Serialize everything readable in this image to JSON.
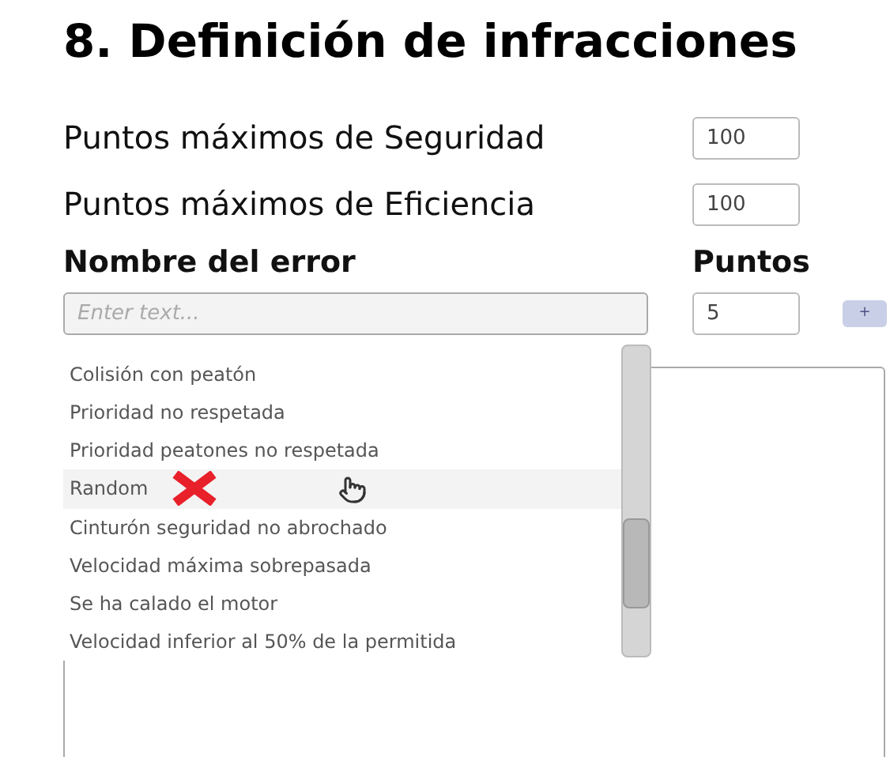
{
  "title": "8. Definición de infracciones",
  "max_points": [
    {
      "label": "Puntos máximos de Seguridad",
      "value": "100"
    },
    {
      "label": "Puntos máximos de Eficiencia",
      "value": "100"
    }
  ],
  "columns": {
    "name": "Nombre del error",
    "points": "Puntos"
  },
  "name_field": {
    "placeholder": "Enter text..."
  },
  "points_field": {
    "value": "5"
  },
  "add_button": {
    "label": "+",
    "disabled": true
  },
  "suggestions": [
    {
      "label": "Colisión con peatón",
      "hovered": false
    },
    {
      "label": "Prioridad no respetada",
      "hovered": false
    },
    {
      "label": "Prioridad peatones no respetada",
      "hovered": false
    },
    {
      "label": "Random",
      "hovered": true
    },
    {
      "label": "Cinturón seguridad no abrochado",
      "hovered": false
    },
    {
      "label": "Velocidad máxima sobrepasada",
      "hovered": false
    },
    {
      "label": "Se ha calado el motor",
      "hovered": false
    },
    {
      "label": "Velocidad inferior al 50% de la permitida",
      "hovered": false
    }
  ]
}
